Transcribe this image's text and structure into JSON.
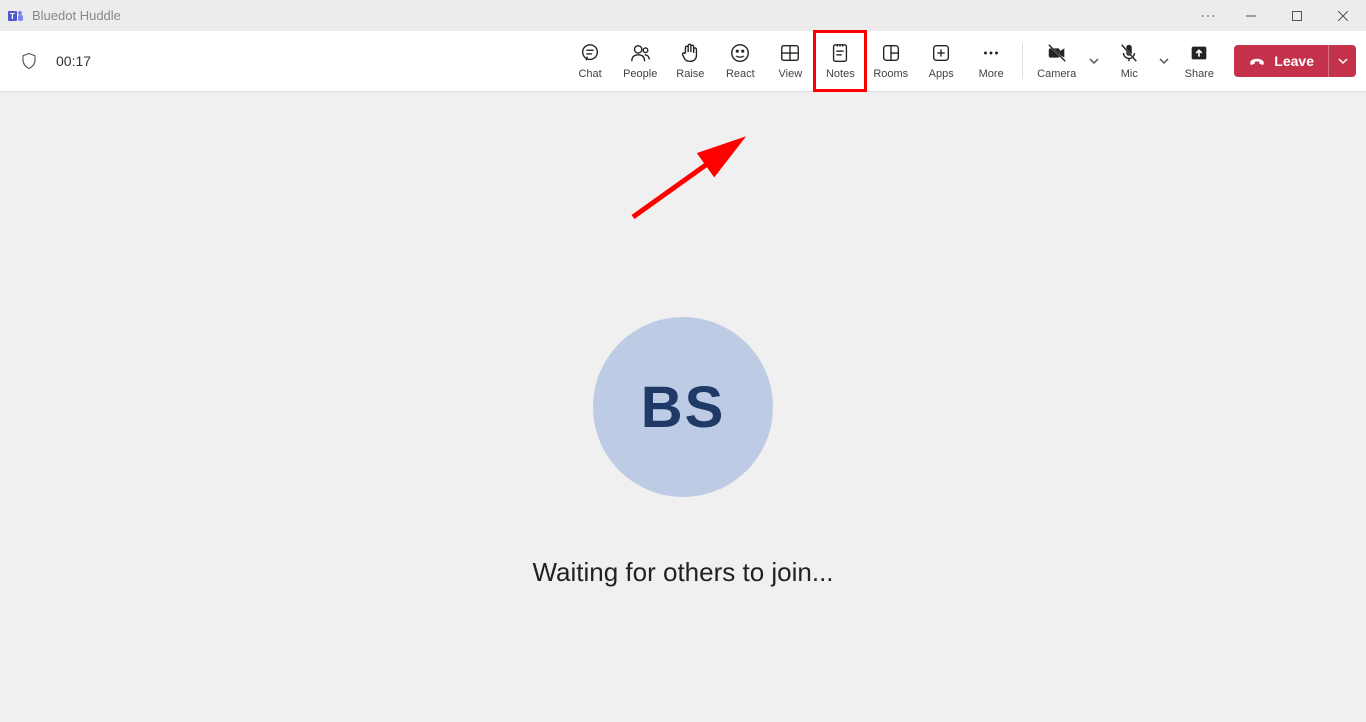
{
  "titlebar": {
    "title": "Bluedot Huddle"
  },
  "toolbar": {
    "timer": "00:17",
    "chat": "Chat",
    "people": "People",
    "raise": "Raise",
    "react": "React",
    "view": "View",
    "notes": "Notes",
    "rooms": "Rooms",
    "apps": "Apps",
    "more": "More",
    "camera": "Camera",
    "mic": "Mic",
    "share": "Share",
    "leave": "Leave"
  },
  "main": {
    "avatar_initials": "BS",
    "waiting_text": "Waiting for others to join..."
  }
}
